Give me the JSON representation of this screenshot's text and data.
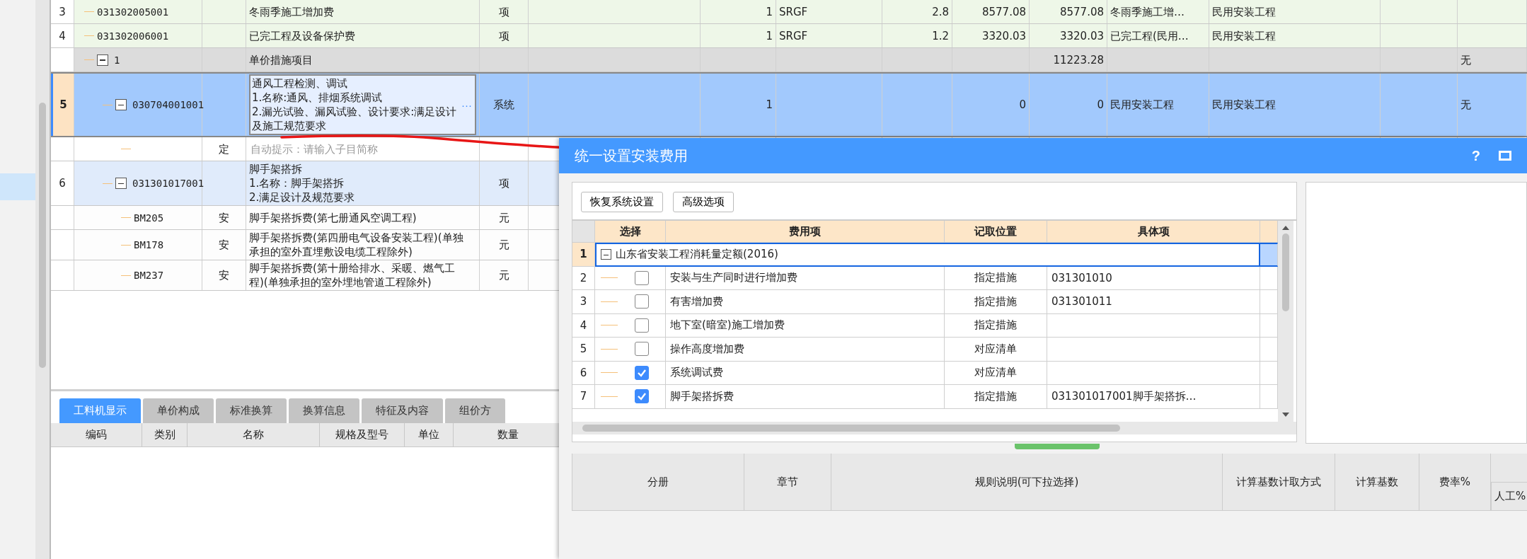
{
  "main_table": {
    "rows": [
      {
        "kind": "item",
        "selected": false,
        "number": "3",
        "code": "031302005001",
        "name": "冬雨季施工增加费",
        "unit": "项",
        "quantity": "1",
        "column_8": "SRGF",
        "column_9": "2.8",
        "column_10": "8577.08",
        "column_11": "8577.08",
        "column_12": "冬雨季施工增…",
        "column_13": "民用安装工程"
      },
      {
        "kind": "item",
        "selected": false,
        "number": "4",
        "code": "031302006001",
        "name": "已完工程及设备保护费",
        "unit": "项",
        "quantity": "1",
        "column_8": "SRGF",
        "column_9": "1.2",
        "column_10": "3320.03",
        "column_11": "3320.03",
        "column_12": "已完工程(民用…",
        "column_13": "民用安装工程"
      },
      {
        "kind": "group",
        "selected": false,
        "expanded": true,
        "code": "1",
        "name": "单价措施项目",
        "column_11": "11223.28",
        "column_15": "无",
        "children": [
          {
            "kind": "list_item",
            "selected": true,
            "expanded": true,
            "number": "5",
            "code": "030704001001",
            "name_lines": [
              "通风工程检测、调试",
              "1.名称:通风、排烟系统调试",
              "2.漏光试验、漏风试验、设计要求:满足设计及施工规范要求"
            ],
            "edit_button": "···",
            "unit": "系统",
            "quantity": "1",
            "column_10": "0",
            "column_11": "0",
            "column_12": "民用安装工程",
            "column_13": "民用安装工程",
            "column_15": "无",
            "children": [
              {
                "kind": "sub",
                "selected": false,
                "type": "定",
                "placeholder": "自动提示：请输入子目简称"
              }
            ]
          },
          {
            "kind": "list_item",
            "selected": false,
            "expanded": true,
            "number": "6",
            "code": "031301017001",
            "name_lines": [
              "脚手架搭拆",
              "1.名称：脚手架搭拆",
              "2.满足设计及规范要求"
            ],
            "unit": "项",
            "children": [
              {
                "kind": "fee",
                "selected": false,
                "code": "BM205",
                "type": "安",
                "name": "脚手架搭拆费(第七册通风空调工程)",
                "unit": "元"
              },
              {
                "kind": "fee",
                "selected": false,
                "code": "BM178",
                "type": "安",
                "name": "脚手架搭拆费(第四册电气设备安装工程)(单独承担的室外直埋敷设电缆工程除外)",
                "unit": "元"
              },
              {
                "kind": "fee",
                "selected": false,
                "code": "BM237",
                "type": "安",
                "name": "脚手架搭拆费(第十册给排水、采暖、燃气工程)(单独承担的室外埋地管道工程除外)",
                "unit": "元"
              }
            ]
          }
        ]
      }
    ]
  },
  "bottom_panel": {
    "tabs": [
      {
        "label": "工料机显示",
        "selected": true
      },
      {
        "label": "单价构成",
        "selected": false
      },
      {
        "label": "标准换算",
        "selected": false
      },
      {
        "label": "换算信息",
        "selected": false
      },
      {
        "label": "特征及内容",
        "selected": false
      },
      {
        "label": "组价方",
        "selected": false
      }
    ],
    "columns": [
      "编码",
      "类别",
      "名称",
      "规格及型号",
      "单位",
      "数量"
    ]
  },
  "dialog": {
    "title": "统一设置安装费用",
    "help": "?",
    "buttons": [
      "恢复系统设置",
      "高级选项"
    ],
    "grid": {
      "columns": [
        "选择",
        "费用项",
        "记取位置",
        "具体项"
      ],
      "rows": [
        {
          "number": "1",
          "label": "山东省安装工程消耗量定额(2016)",
          "expanded": true,
          "selected": true,
          "children": [
            {
              "number": "2",
              "checked": false,
              "name": "安装与生产同时进行增加费",
              "position": "指定措施",
              "item": "031301010"
            },
            {
              "number": "3",
              "checked": false,
              "name": "有害增加费",
              "position": "指定措施",
              "item": "031301011"
            },
            {
              "number": "4",
              "checked": false,
              "name": "地下室(暗室)施工增加费",
              "position": "指定措施"
            },
            {
              "number": "5",
              "checked": false,
              "name": "操作高度增加费",
              "position": "对应清单"
            },
            {
              "number": "6",
              "checked": true,
              "name": "系统调试费",
              "position": "对应清单"
            },
            {
              "number": "7",
              "checked": true,
              "name": "脚手架搭拆费",
              "position": "指定措施",
              "item": "031301017001脚手架搭拆…"
            }
          ]
        }
      ]
    },
    "rules_table": {
      "columns": [
        "分册",
        "章节",
        "规则说明(可下拉选择)",
        "计算基数计取方式",
        "计算基数",
        "费率%"
      ],
      "subcolumns": [
        "人工%"
      ]
    }
  }
}
